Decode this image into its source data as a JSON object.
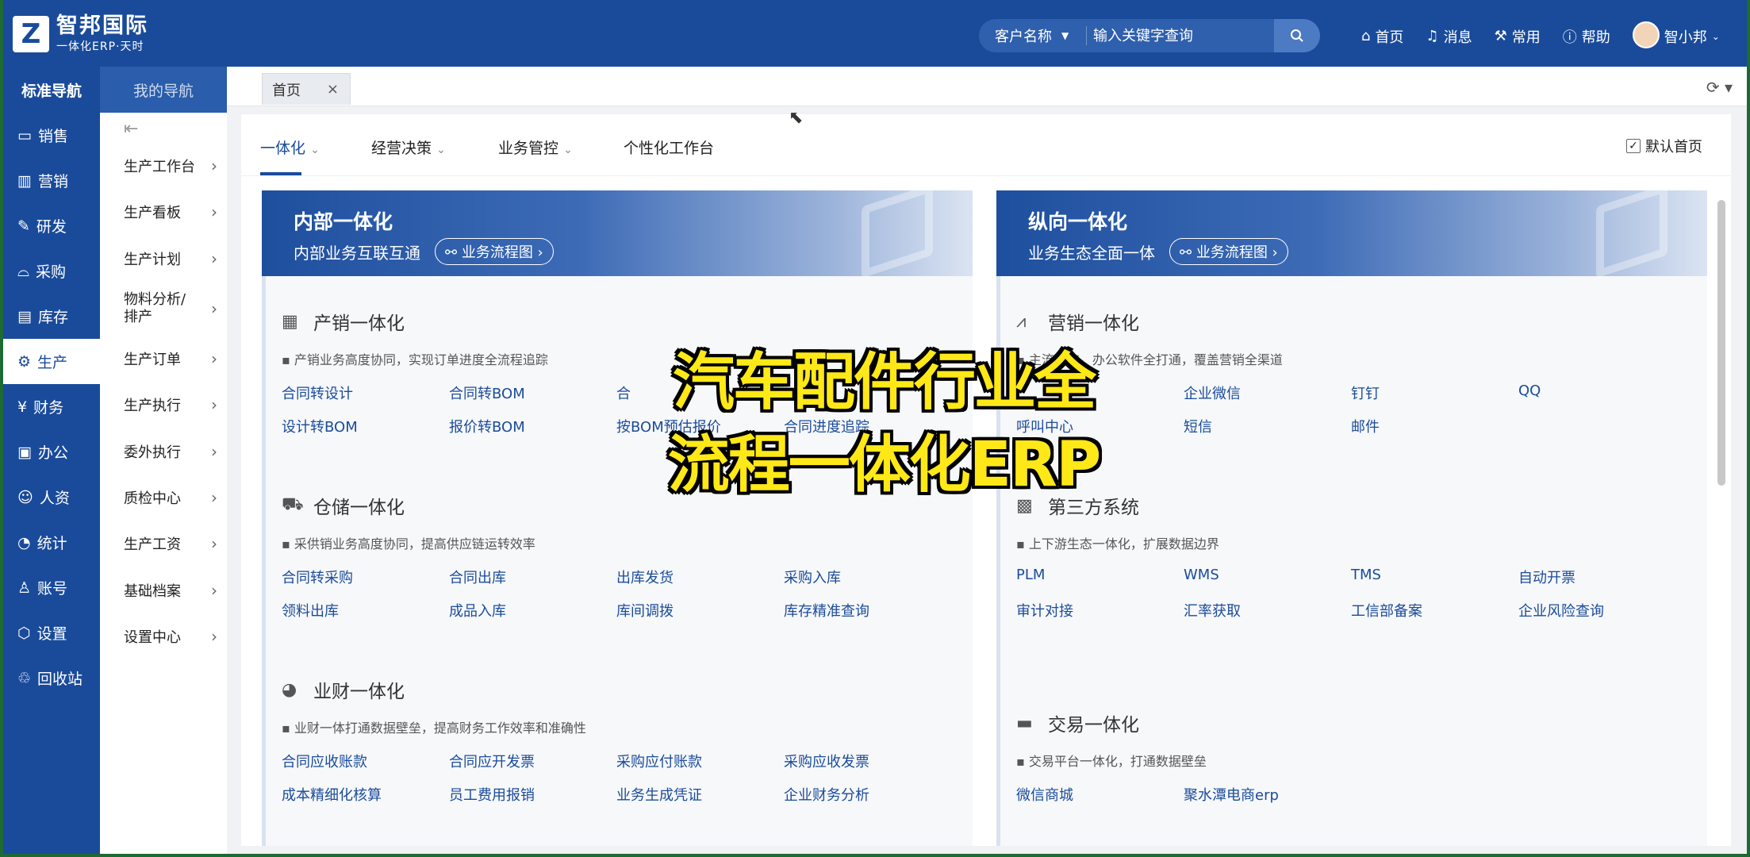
{
  "header": {
    "logo_mark": "Z",
    "logo_name": "智邦国际",
    "logo_slogan": "一体化ERP·天时",
    "search_category": "客户名称",
    "search_placeholder": "输入关键字查询",
    "nav": [
      {
        "label": "首页",
        "icon": "home-icon"
      },
      {
        "label": "消息",
        "icon": "bell-icon"
      },
      {
        "label": "常用",
        "icon": "tool-icon"
      },
      {
        "label": "帮助",
        "icon": "help-icon"
      }
    ],
    "user": "智小邦"
  },
  "nav1": {
    "tab": "标准导航",
    "items": [
      {
        "label": "销售",
        "icon": "chat-icon"
      },
      {
        "label": "营销",
        "icon": "bar-chart-icon"
      },
      {
        "label": "研发",
        "icon": "flask-icon"
      },
      {
        "label": "采购",
        "icon": "basket-icon"
      },
      {
        "label": "库存",
        "icon": "inventory-icon"
      },
      {
        "label": "生产",
        "icon": "production-icon"
      },
      {
        "label": "财务",
        "icon": "yen-icon"
      },
      {
        "label": "办公",
        "icon": "briefcase-icon"
      },
      {
        "label": "人资",
        "icon": "person-icon"
      },
      {
        "label": "统计",
        "icon": "pie-icon"
      },
      {
        "label": "账号",
        "icon": "account-icon"
      },
      {
        "label": "设置",
        "icon": "settings-icon"
      },
      {
        "label": "回收站",
        "icon": "trash-icon"
      }
    ],
    "active": "生产"
  },
  "nav2": {
    "tab": "我的导航",
    "items": [
      "生产工作台",
      "生产看板",
      "生产计划",
      "物料分析/排产",
      "生产订单",
      "生产执行",
      "委外执行",
      "质检中心",
      "生产工资",
      "基础档案",
      "设置中心"
    ]
  },
  "tabbar": {
    "tab": "首页"
  },
  "subtabs": {
    "items": [
      {
        "label": "一体化",
        "dropdown": true
      },
      {
        "label": "经营决策",
        "dropdown": true
      },
      {
        "label": "业务管控",
        "dropdown": true
      },
      {
        "label": "个性化工作台",
        "dropdown": false
      }
    ],
    "default_home": "默认首页"
  },
  "panels": [
    {
      "title": "内部一体化",
      "subtitle": "内部业务互联互通",
      "flow_button": "业务流程图",
      "sections": [
        {
          "title": "产销一体化",
          "icon": "building-icon",
          "desc": "▪ 产销业务高度协同，实现订单进度全流程追踪",
          "links": [
            "合同转设计",
            "合同转BOM",
            "合",
            "",
            "设计转BOM",
            "报价转BOM",
            "按BOM预估报价",
            "合同进度追踪"
          ]
        },
        {
          "title": "仓储一体化",
          "icon": "truck-icon",
          "desc": "▪ 采供销业务高度协同，提高供应链运转效率",
          "links": [
            "合同转采购",
            "合同出库",
            "出库发货",
            "采购入库",
            "领料出库",
            "成品入库",
            "库间调拨",
            "库存精准查询"
          ]
        },
        {
          "title": "业财一体化",
          "icon": "pie-chart-icon",
          "desc": "▪ 业财一体打通数据壁垒，提高财务工作效率和准确性",
          "links": [
            "合同应收账款",
            "合同应开发票",
            "采购应付账款",
            "采购应收发票",
            "成本精细化核算",
            "员工费用报销",
            "业务生成凭证",
            "企业财务分析"
          ]
        }
      ]
    },
    {
      "title": "纵向一体化",
      "subtitle": "业务生态全面一体",
      "flow_button": "业务流程图",
      "sections": [
        {
          "title": "营销一体化",
          "icon": "trend-icon",
          "desc": "▪ 主流社交、办公软件全打通，覆盖营销全渠道",
          "links": [
            "",
            "企业微信",
            "钉钉",
            "QQ",
            "呼叫中心",
            "短信",
            "邮件",
            ""
          ]
        },
        {
          "title": "第三方系统",
          "icon": "system-icon",
          "desc": "▪ 上下游生态一体化，扩展数据边界",
          "links": [
            "PLM",
            "WMS",
            "TMS",
            "自动开票",
            "审计对接",
            "汇率获取",
            "工信部备案",
            "企业风险查询"
          ]
        },
        {
          "title": "交易一体化",
          "icon": "card-icon",
          "desc": "▪ 交易平台一体化，打通数据壁垒",
          "links": [
            "微信商城",
            "聚水潭电商erp",
            "",
            ""
          ]
        }
      ]
    }
  ],
  "overlay": {
    "line1": "汽车配件行业全",
    "line2": "流程一体化ERP"
  }
}
